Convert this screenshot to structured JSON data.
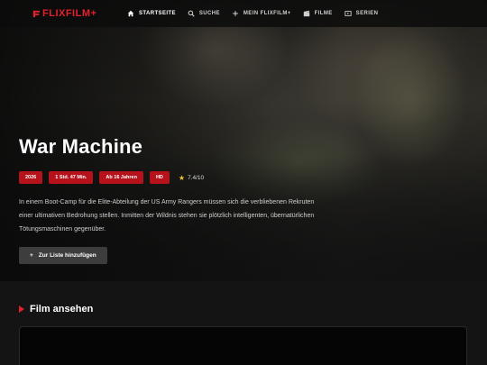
{
  "brand": {
    "name": "FLIXFILM+",
    "accent": "#e4202b"
  },
  "nav": {
    "items": [
      {
        "label": "STARTSEITE",
        "icon": "home-icon",
        "active": true
      },
      {
        "label": "SUCHE",
        "icon": "search-icon",
        "active": false
      },
      {
        "label": "MEIN FLIXFILM+",
        "icon": "plus-icon",
        "active": false
      },
      {
        "label": "FILME",
        "icon": "film-icon",
        "active": false
      },
      {
        "label": "SERIEN",
        "icon": "tv-icon",
        "active": false
      }
    ]
  },
  "movie": {
    "title": "War Machine",
    "year": "2026",
    "duration": "1 Std. 47 Min.",
    "age_rating": "Ab 16 Jahren",
    "quality": "HD",
    "rating": "7.4/10",
    "description": "In einem Boot-Camp für die Elite-Abteilung der US Army Rangers müssen sich die verbliebenen Rekruten einer ultimativen Bedrohung stellen. Inmitten der Wildnis stehen sie plötzlich intelligenten, übernatürlichen Tötungsmaschinen gegenüber.",
    "add_button": "Zur Liste hinzufügen"
  },
  "watch_section": {
    "title": "Film ansehen"
  }
}
